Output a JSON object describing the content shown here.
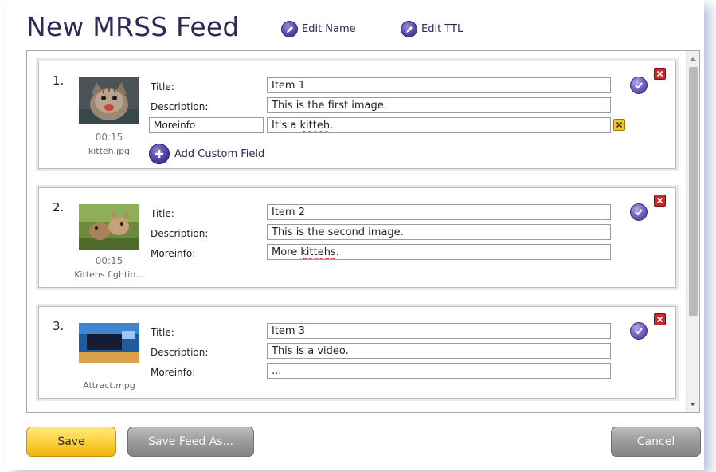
{
  "header": {
    "title": "New MRSS Feed",
    "edit_name_label": "Edit Name",
    "edit_ttl_label": "Edit TTL"
  },
  "items": [
    {
      "number": "1.",
      "duration": "00:15",
      "filename": "kitteh.jpg",
      "title_label": "Title:",
      "title_value": "Item 1",
      "description_label": "Description:",
      "description_value": "This is the first image.",
      "custom_key": "Moreinfo",
      "custom_value_prefix": "It's a ",
      "custom_value_flagged": "kitteh",
      "custom_value_suffix": ".",
      "add_custom_field_label": "Add Custom Field"
    },
    {
      "number": "2.",
      "duration": "00:15",
      "filename": "Kittehs fightin...",
      "title_label": "Title:",
      "title_value": "Item 2",
      "description_label": "Description:",
      "description_value": "This is the second image.",
      "moreinfo_label": "Moreinfo:",
      "moreinfo_prefix": "More ",
      "moreinfo_flagged": "kittehs",
      "moreinfo_suffix": "."
    },
    {
      "number": "3.",
      "filename": "Attract.mpg",
      "title_label": "Title:",
      "title_value": "Item 3",
      "description_label": "Description:",
      "description_value": "This is a video.",
      "moreinfo_label": "Moreinfo:",
      "moreinfo_value": "..."
    }
  ],
  "footer": {
    "save_label": "Save",
    "save_as_label": "Save Feed As...",
    "cancel_label": "Cancel"
  },
  "icons": {
    "edit": "pencil-icon",
    "confirm": "check-icon",
    "delete": "close-icon",
    "add": "plus-icon"
  },
  "colors": {
    "title": "#2b2b56",
    "accent_purple": "#5b47a8",
    "delete_red": "#c62a2a",
    "remove_field_yellow": "#f3c52c",
    "save_yellow": "#fcd23d",
    "button_gray": "#9a9a9a"
  }
}
